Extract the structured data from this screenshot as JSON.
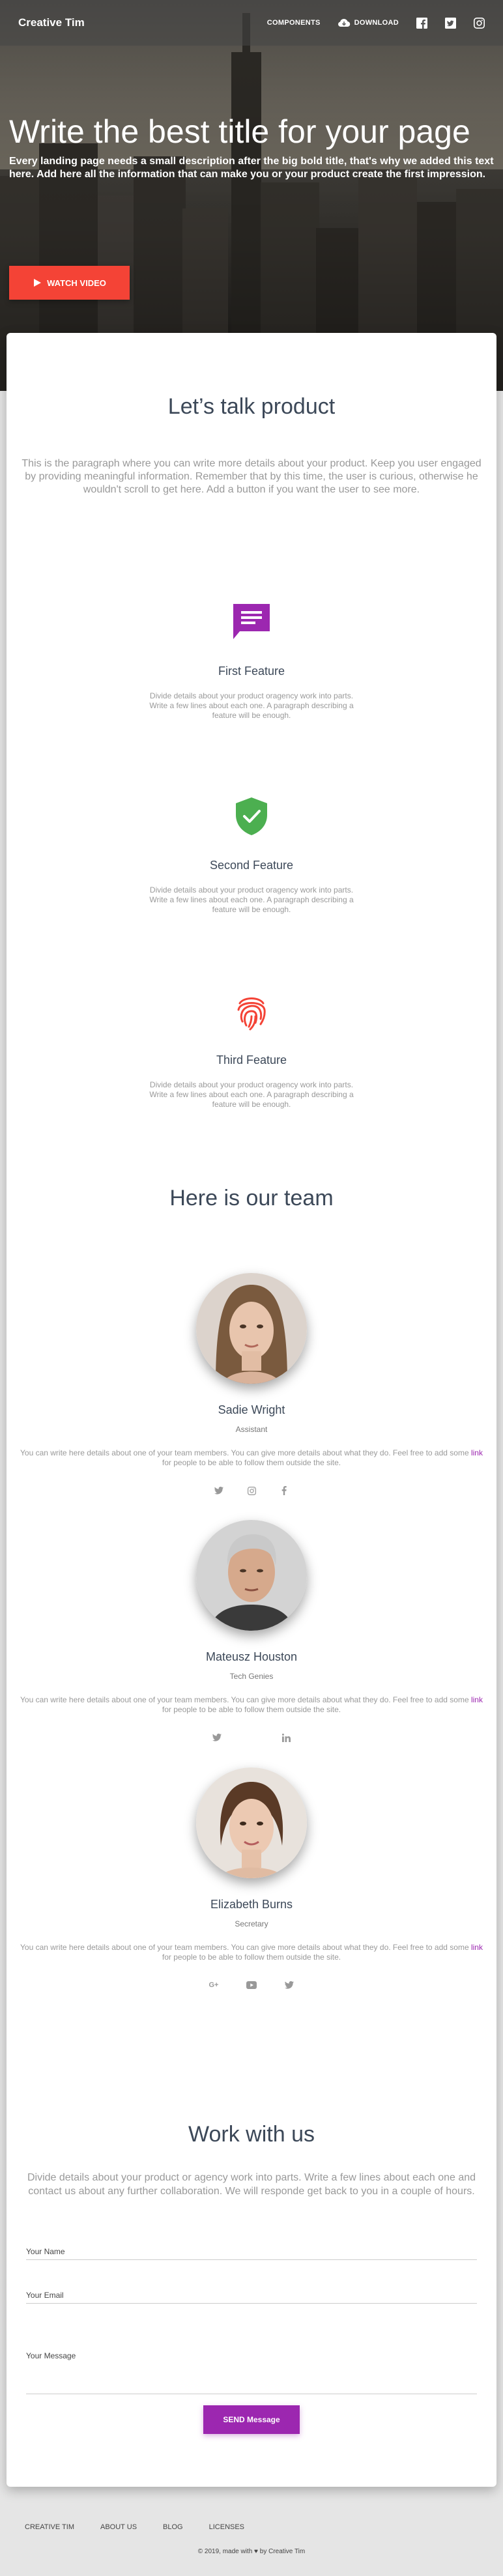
{
  "nav": {
    "brand": "Creative Tim",
    "components": "COMPONENTS",
    "download": "DOWNLOAD",
    "icons": [
      "cloud-download-icon",
      "facebook-icon",
      "twitter-icon",
      "instagram-icon"
    ]
  },
  "hero": {
    "title": "Write the best title for your page",
    "description": "Every landing page needs a small description after the big bold title, that's why we added this text here. Add here all the information that can make you or your product create the first impression.",
    "button": "WATCH VIDEO"
  },
  "product": {
    "title": "Let’s talk product",
    "description": "This is the paragraph where you can write more details about your product. Keep you user engaged by providing meaningful information. Remember that by this time, the user is curious, otherwise he wouldn't scroll to get here. Add a button if you want the user to see more."
  },
  "features": [
    {
      "name": "First Feature",
      "icon": "chat-icon",
      "description": "Divide details about your product oragency work into parts. Write a few lines about each one. A paragraph describing a feature will be enough."
    },
    {
      "name": "Second Feature",
      "icon": "shield-check-icon",
      "description": "Divide details about your product oragency work into parts. Write a few lines about each one. A paragraph describing a feature will be enough."
    },
    {
      "name": "Third Feature",
      "icon": "fingerprint-icon",
      "description": "Divide details about your product oragency work into parts. Write a few lines about each one. A paragraph describing a feature will be enough."
    }
  ],
  "team": {
    "title": "Here is our team",
    "desc_before": "You can write here details about one of your team members. You can give more details about what they do. Feel free to add some ",
    "desc_link": "link",
    "desc_after": " for people to be able to follow them outside the site.",
    "members": [
      {
        "name": "Sadie Wright",
        "role": "Assistant",
        "socials": [
          "twitter-icon",
          "instagram-icon",
          "facebook-icon"
        ]
      },
      {
        "name": "Mateusz Houston",
        "role": "Tech Genies",
        "socials": [
          "twitter-icon",
          "linkedin-icon"
        ]
      },
      {
        "name": "Elizabeth Burns",
        "role": "Secretary",
        "socials": [
          "google-plus-icon",
          "youtube-icon",
          "twitter-icon"
        ]
      }
    ]
  },
  "contact": {
    "title": "Work with us",
    "description": "Divide details about your product or agency work into parts. Write a few lines about each one and contact us about any further collaboration. We will responde get back to you in a couple of hours.",
    "name_label": "Your Name",
    "email_label": "Your Email",
    "message_label": "Your Message",
    "button": "SEND Message"
  },
  "footer": {
    "links": [
      "CREATIVE TIM",
      "ABOUT US",
      "BLOG",
      "LICENSES"
    ],
    "copyright": "© 2019, made with ♥ by Creative Tim"
  }
}
